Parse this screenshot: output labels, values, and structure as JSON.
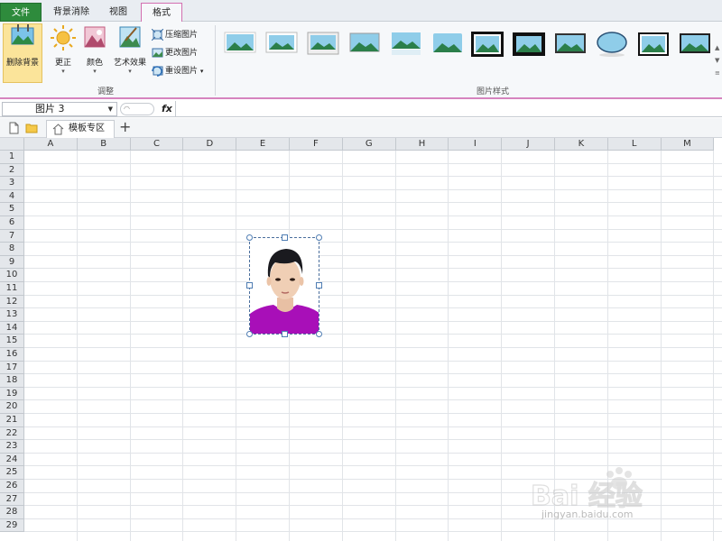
{
  "tabs": [
    {
      "label": "文件",
      "active": false
    },
    {
      "label": "背景消除",
      "active": false
    },
    {
      "label": "视图",
      "active": false
    },
    {
      "label": "格式",
      "active": true
    }
  ],
  "ribbon": {
    "adjust": {
      "remove_bg": "删除背景",
      "correct": "更正",
      "color": "颜色",
      "art_effects": "艺术效果",
      "compress": "压缩图片",
      "change": "更改图片",
      "reset": "重设图片",
      "group_label": "调整"
    },
    "styles": {
      "group_label": "图片样式",
      "count": 12
    }
  },
  "formula_bar": {
    "name_box": "图片 3",
    "fx": "fx",
    "content": ""
  },
  "doc_tabs": {
    "active_tab": "模板专区",
    "add": "+"
  },
  "sheet": {
    "columns": [
      "A",
      "B",
      "C",
      "D",
      "E",
      "F",
      "G",
      "H",
      "I",
      "J",
      "K",
      "L",
      "M"
    ],
    "rows": [
      "1",
      "2",
      "3",
      "4",
      "5",
      "6",
      "7",
      "8",
      "9",
      "10",
      "11",
      "12",
      "13",
      "14",
      "15",
      "16",
      "17",
      "18",
      "19",
      "20",
      "21",
      "22",
      "23",
      "24",
      "25",
      "26",
      "27",
      "28",
      "29"
    ]
  },
  "watermark": {
    "brand": "Bai 经验",
    "url": "jingyan.baidu.com"
  },
  "colors": {
    "file_tab": "#2e8b3c",
    "format_accent": "#d684bf",
    "highlight": "#fbe49a",
    "shirt": "#a80fb8"
  }
}
